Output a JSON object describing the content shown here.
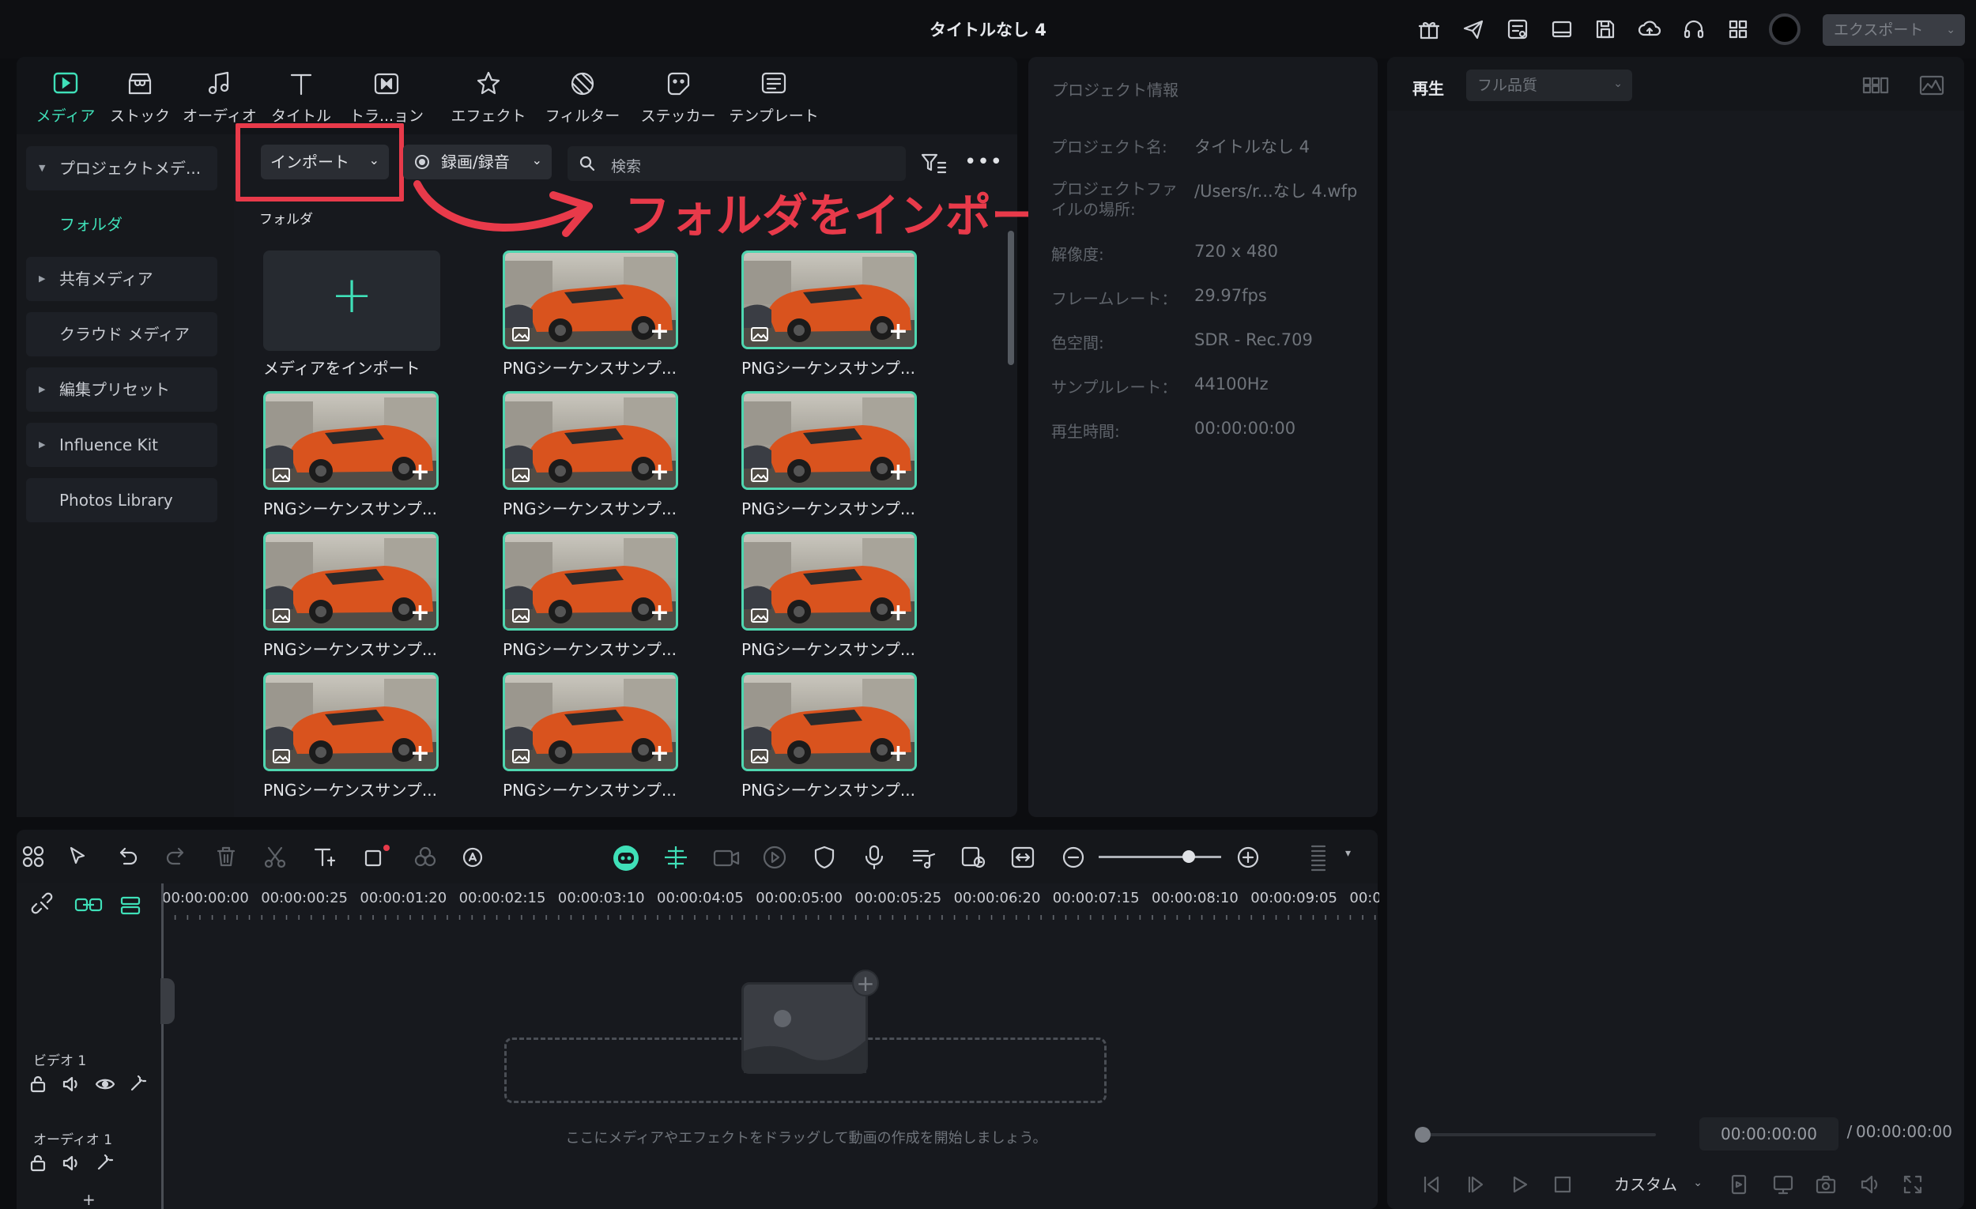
{
  "window_title": "タイトルなし 4",
  "export_button": "エクスポート",
  "tabs": [
    {
      "label": "メディア",
      "icon": "media-icon"
    },
    {
      "label": "ストック",
      "icon": "stock-icon"
    },
    {
      "label": "オーディオ",
      "icon": "audio-note-icon"
    },
    {
      "label": "タイトル",
      "icon": "title-t-icon"
    },
    {
      "label": "トラ...ョン",
      "icon": "transition-icon"
    },
    {
      "label": "エフェクト",
      "icon": "effect-star-icon"
    },
    {
      "label": "フィルター",
      "icon": "filter-icon"
    },
    {
      "label": "ステッカー",
      "icon": "sticker-icon"
    },
    {
      "label": "テンプレート",
      "icon": "template-icon"
    }
  ],
  "sidebar": {
    "items": [
      {
        "label": "プロジェクトメデ...",
        "expandable": true
      },
      {
        "label": "フォルダ",
        "active": true
      },
      {
        "label": "共有メディア",
        "expandable": true
      },
      {
        "label": "クラウド メディア"
      },
      {
        "label": "編集プリセット",
        "expandable": true
      },
      {
        "label": "Influence Kit",
        "expandable": true
      },
      {
        "label": "Photos Library"
      }
    ]
  },
  "toolbar": {
    "import_label": "インポート",
    "record_label": "録画/録音",
    "search_placeholder": "検索",
    "folder_label": "フォルダ"
  },
  "annotation": {
    "text": "フォルダをインポート",
    "color": "#e83a4a"
  },
  "media": {
    "import_tile_label": "メディアをインポート",
    "item_label": "PNGシーケンスサンプ...",
    "item_count": 11
  },
  "project_info": {
    "heading": "プロジェクト情報",
    "rows": [
      {
        "label": "プロジェクト名:",
        "value": "タイトルなし 4"
      },
      {
        "label": "プロジェクトファイルの場所:",
        "value": "/Users/r...なし 4.wfp"
      },
      {
        "label": "解像度:",
        "value": "720 x 480"
      },
      {
        "label": "フレームレート：",
        "value": "29.97fps"
      },
      {
        "label": "色空間:",
        "value": "SDR - Rec.709"
      },
      {
        "label": "サンプルレート：",
        "value": "44100Hz"
      },
      {
        "label": "再生時間:",
        "value": "00:00:00:00"
      }
    ]
  },
  "player": {
    "tab_label": "再生",
    "quality": "フル品質",
    "current_time": "00:00:00:00",
    "separator": "/",
    "total_time": "00:00:00:00",
    "ratio_label": "カスタム"
  },
  "timeline": {
    "ticks": [
      "00:00:00:00",
      "00:00:00:25",
      "00:00:01:20",
      "00:00:02:15",
      "00:00:03:10",
      "00:00:04:05",
      "00:00:05:00",
      "00:00:05:25",
      "00:00:06:20",
      "00:00:07:15",
      "00:00:08:10",
      "00:00:09:05",
      "00:00"
    ],
    "video_track": "ビデオ 1",
    "audio_track": "オーディオ 1",
    "drop_hint": "ここにメディアやエフェクトをドラッグして動画の作成を開始しましょう。",
    "add_track": "+"
  },
  "colors": {
    "accent": "#3fe0b8",
    "highlight": "#e83a4a",
    "panel": "#17191e"
  }
}
